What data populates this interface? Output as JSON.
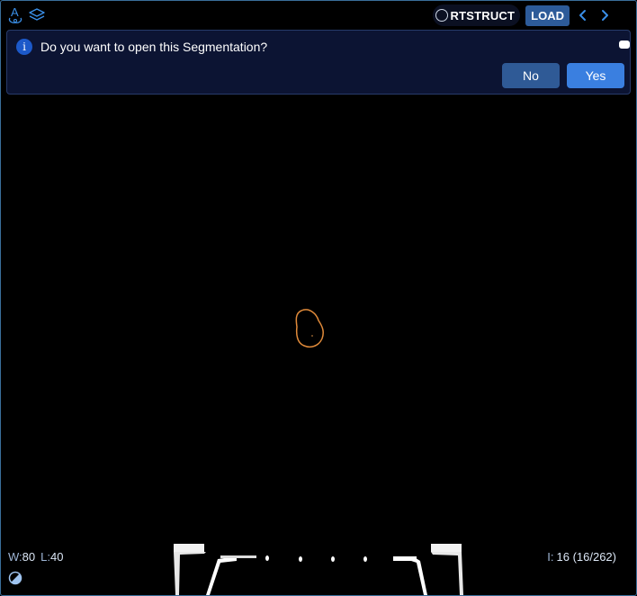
{
  "toolbar": {
    "left_icons": [
      "tracking-icon",
      "layers-icon"
    ],
    "status_label": "RTSTRUCT",
    "load_label": "LOAD",
    "prev_icon": "chevron-left-icon",
    "next_icon": "chevron-right-icon"
  },
  "prompt": {
    "info_glyph": "i",
    "message": "Do you want to open this Segmentation?",
    "no_label": "No",
    "yes_label": "Yes"
  },
  "overlay": {
    "window_key": "W:",
    "window_value": "80",
    "level_key": "L:",
    "level_value": "40",
    "index_key": "I:",
    "index_value": "16 (16/262)"
  },
  "colors": {
    "accent": "#3a7fe0",
    "contour": "#e08a3a",
    "viewport_border": "#3a6e9a"
  }
}
